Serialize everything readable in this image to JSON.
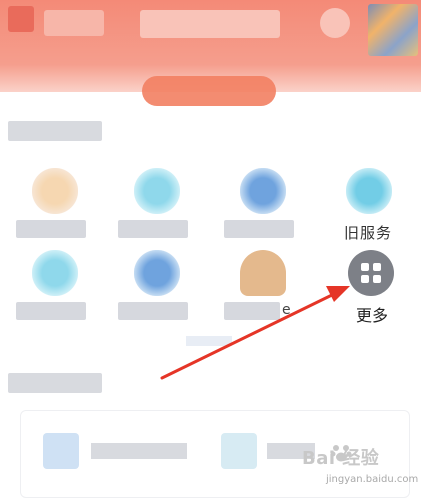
{
  "services": {
    "peek_label": "旧服务",
    "partial_char": "e",
    "more": {
      "label": "更多",
      "icon": "grid-icon"
    }
  },
  "colors": {
    "header": "#f48a77",
    "arrow": "#e53527",
    "more_button": "#7d8087"
  },
  "watermark": {
    "main": "Bai 经验",
    "sub": "jingyan.baidu.com"
  }
}
